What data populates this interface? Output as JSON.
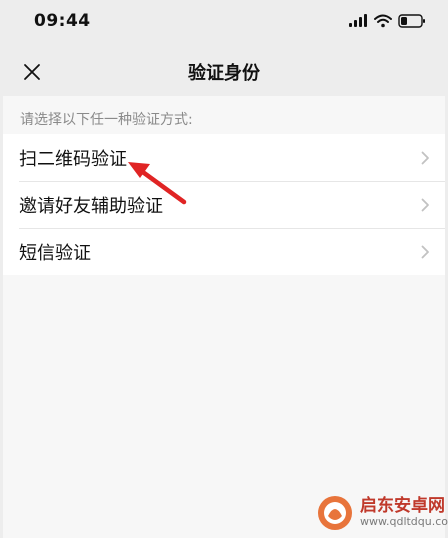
{
  "status_bar": {
    "time": "09:44"
  },
  "nav": {
    "title": "验证身份"
  },
  "section": {
    "hint": "请选择以下任一种验证方式:"
  },
  "items": [
    {
      "label": "扫二维码验证"
    },
    {
      "label": "邀请好友辅助验证"
    },
    {
      "label": "短信验证"
    }
  ],
  "watermark": {
    "brand": "启东安卓网",
    "url": "www.qdltdqu.com"
  },
  "colors": {
    "accent_arrow": "#e02424",
    "background": "#ededed",
    "list_background": "#ffffff",
    "hint_text": "#8a8a8a"
  },
  "icons": {
    "close": "close-icon",
    "chevron": "chevron-right-icon",
    "signal": "signal-icon",
    "wifi": "wifi-icon",
    "battery": "battery-icon"
  }
}
